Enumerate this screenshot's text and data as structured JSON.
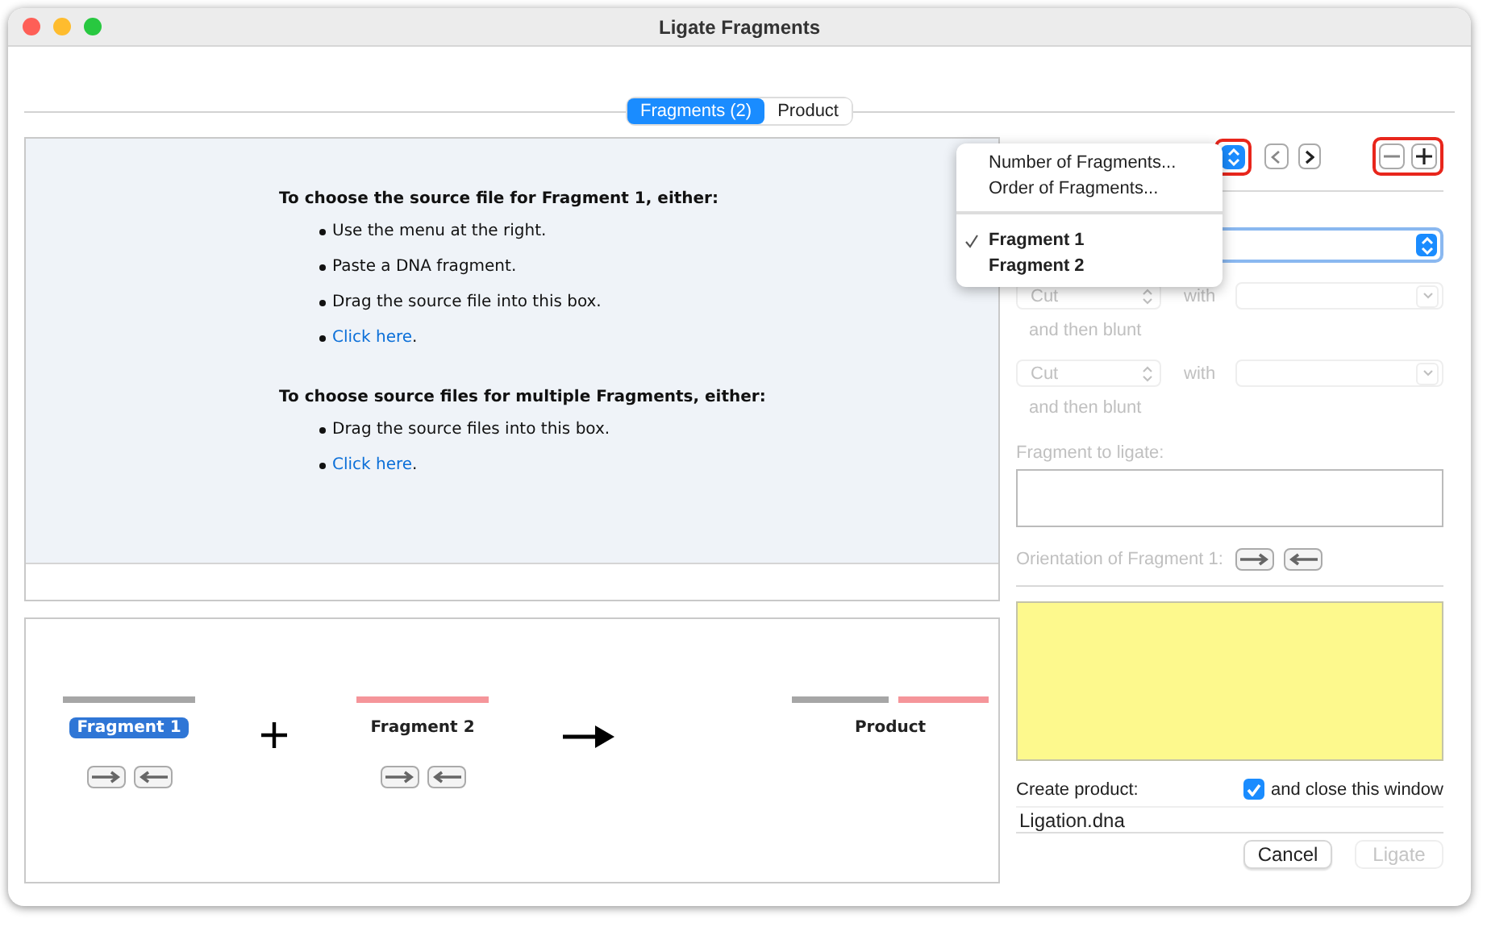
{
  "window": {
    "title": "Ligate Fragments"
  },
  "tabs": [
    {
      "label": "Fragments (2)",
      "selected": true
    },
    {
      "label": "Product",
      "selected": false
    }
  ],
  "instructions": [
    {
      "heading": "To choose the source file for Fragment 1, either:",
      "items": [
        {
          "kind": "text",
          "text": "Use the menu at the right."
        },
        {
          "kind": "text",
          "text": "Paste a DNA fragment."
        },
        {
          "kind": "text",
          "text": "Drag the source file into this box."
        },
        {
          "kind": "link",
          "text": "Click here",
          "after": "."
        }
      ]
    },
    {
      "heading": "To choose source files for multiple Fragments, either:",
      "items": [
        {
          "kind": "text",
          "text": "Drag the source files into this box."
        },
        {
          "kind": "link",
          "text": "Click here",
          "after": "."
        }
      ]
    }
  ],
  "diagram": {
    "fragments": [
      {
        "label": "Fragment 1",
        "selected": true,
        "color": "#a6a6a6"
      },
      {
        "label": "Fragment 2",
        "selected": false,
        "color": "#f5959a"
      }
    ],
    "product": {
      "label": "Product"
    }
  },
  "menu": {
    "items": [
      {
        "kind": "action",
        "label": "Number of Fragments..."
      },
      {
        "kind": "action",
        "label": "Order of Fragments..."
      },
      {
        "kind": "fragment",
        "label": "Fragment 1",
        "checked": true
      },
      {
        "kind": "fragment",
        "label": "Fragment 2",
        "checked": false
      }
    ]
  },
  "ends": [
    {
      "enzyme": "Cut",
      "with": "with",
      "then": "and then blunt",
      "disabled": true
    },
    {
      "enzyme": "Cut",
      "with": "with",
      "then": "and then blunt",
      "disabled": true
    }
  ],
  "fragment_to_ligate": {
    "label": "Fragment to ligate:",
    "disabled": true
  },
  "orientation": {
    "label": "Orientation of Fragment 1:",
    "disabled": true
  },
  "create_product": {
    "label": "Create product:",
    "close_label": "and close this window",
    "close_checked": true,
    "filename": "Ligation.dna"
  },
  "buttons": [
    {
      "label": "Cancel",
      "disabled": false
    },
    {
      "label": "Ligate",
      "disabled": true
    }
  ]
}
